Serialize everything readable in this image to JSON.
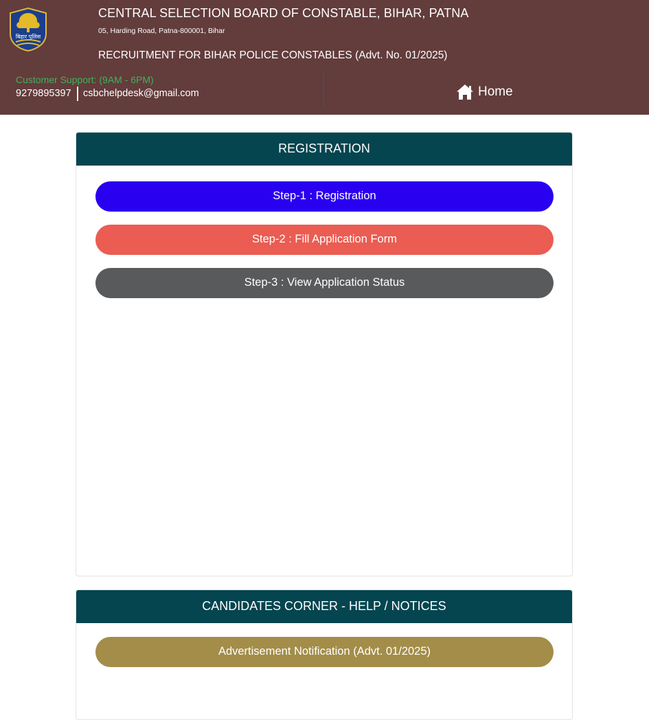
{
  "header": {
    "logo_text": "बिहार पुलिस",
    "org_title": "CENTRAL SELECTION BOARD OF CONSTABLE, BIHAR, PATNA",
    "org_address": "05, Harding Road, Patna-800001, Bihar",
    "recruitment_title": "RECRUITMENT FOR BIHAR POLICE CONSTABLES (Advt. No. 01/2025)",
    "support_label": "Customer Support: (9AM - 6PM)",
    "support_phone": "9279895397",
    "support_email": "csbchelpdesk@gmail.com",
    "home_label": "Home",
    "home_icon": "home-icon"
  },
  "registration": {
    "heading": "REGISTRATION",
    "steps": [
      {
        "label": "Step-1 : Registration",
        "color": "#2a00f0"
      },
      {
        "label": "Step-2 : Fill Application Form",
        "color": "#eb5c52"
      },
      {
        "label": "Step-3 : View Application Status",
        "color": "#585a5c"
      }
    ]
  },
  "candidates_corner": {
    "heading": "CANDIDATES CORNER - HELP / NOTICES",
    "items": [
      {
        "label": "Advertisement Notification (Advt. 01/2025)",
        "color": "#a38d49"
      }
    ]
  },
  "colors": {
    "header_bg": "#633c3c",
    "panel_head_bg": "#05454f",
    "support_label": "#3fb25a"
  }
}
